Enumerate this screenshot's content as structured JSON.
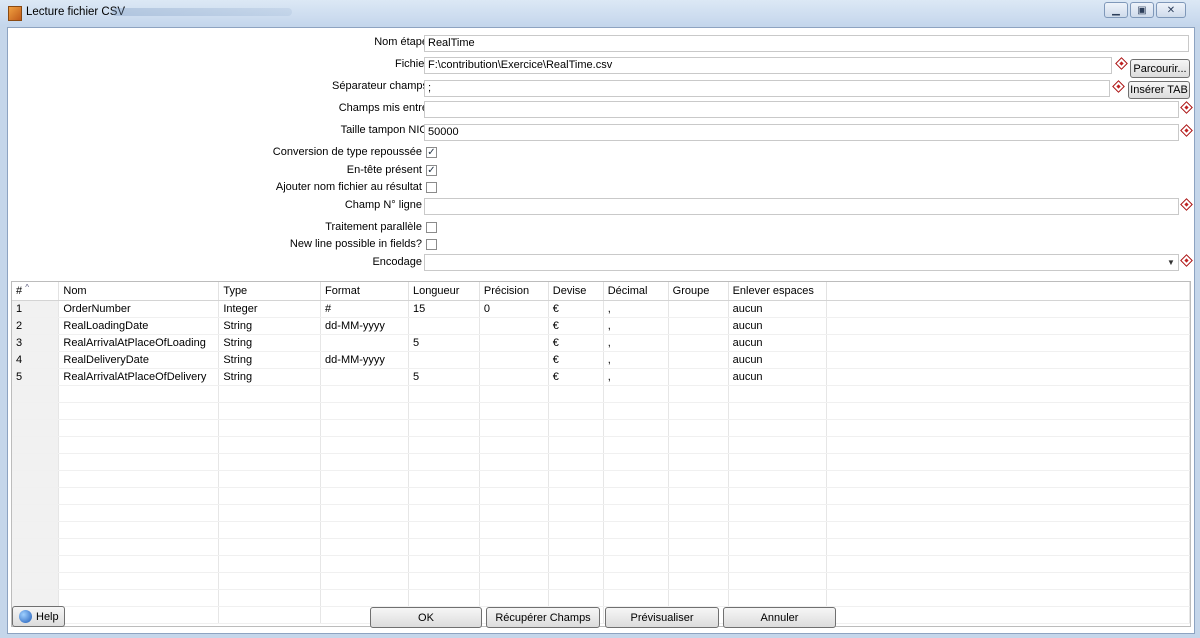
{
  "window": {
    "title": "Lecture fichier CSV",
    "controls": [
      "minimize-icon",
      "maximize-icon",
      "close-icon"
    ]
  },
  "form": {
    "step_name": {
      "label": "Nom étape",
      "value": "RealTime"
    },
    "file": {
      "label": "Fichier",
      "value": "F:\\contribution\\Exercice\\RealTime.csv",
      "browse_label": "Parcourir..."
    },
    "separator": {
      "label": "Séparateur champs",
      "value": ";",
      "insert_tab_label": "Insérer TAB"
    },
    "enclosure": {
      "label": "Champs mis entre",
      "value": ""
    },
    "nio_buffer": {
      "label": "Taille tampon NIO",
      "value": "50000"
    },
    "lazy_conversion": {
      "label": "Conversion de type repoussée",
      "checked": true
    },
    "header_present": {
      "label": "En-tête présent",
      "checked": true
    },
    "add_filename": {
      "label": "Ajouter nom fichier au résultat",
      "checked": false
    },
    "row_num_field": {
      "label": "Champ N° ligne",
      "value": ""
    },
    "parallel": {
      "label": "Traitement parallèle",
      "checked": false
    },
    "newline_in_fields": {
      "label": "New line possible in fields?",
      "checked": false
    },
    "encoding": {
      "label": "Encodage",
      "value": ""
    }
  },
  "table": {
    "columns": [
      "#",
      "Nom",
      "Type",
      "Format",
      "Longueur",
      "Précision",
      "Devise",
      "Décimal",
      "Groupe",
      "Enlever espaces"
    ],
    "rows": [
      [
        "1",
        "OrderNumber",
        "Integer",
        "#",
        "15",
        "0",
        "€",
        ",",
        "",
        "aucun"
      ],
      [
        "2",
        "RealLoadingDate",
        "String",
        "dd-MM-yyyy",
        "",
        "",
        "€",
        ",",
        "",
        "aucun"
      ],
      [
        "3",
        "RealArrivalAtPlaceOfLoading",
        "String",
        "",
        "5",
        "",
        "€",
        ",",
        "",
        "aucun"
      ],
      [
        "4",
        "RealDeliveryDate",
        "String",
        "dd-MM-yyyy",
        "",
        "",
        "€",
        ",",
        "",
        "aucun"
      ],
      [
        "5",
        "RealArrivalAtPlaceOfDelivery",
        "String",
        "",
        "5",
        "",
        "€",
        ",",
        "",
        "aucun"
      ]
    ]
  },
  "footer": {
    "help_label": "Help",
    "ok_label": "OK",
    "get_fields_label": "Récupérer Champs",
    "preview_label": "Prévisualiser",
    "cancel_label": "Annuler"
  }
}
